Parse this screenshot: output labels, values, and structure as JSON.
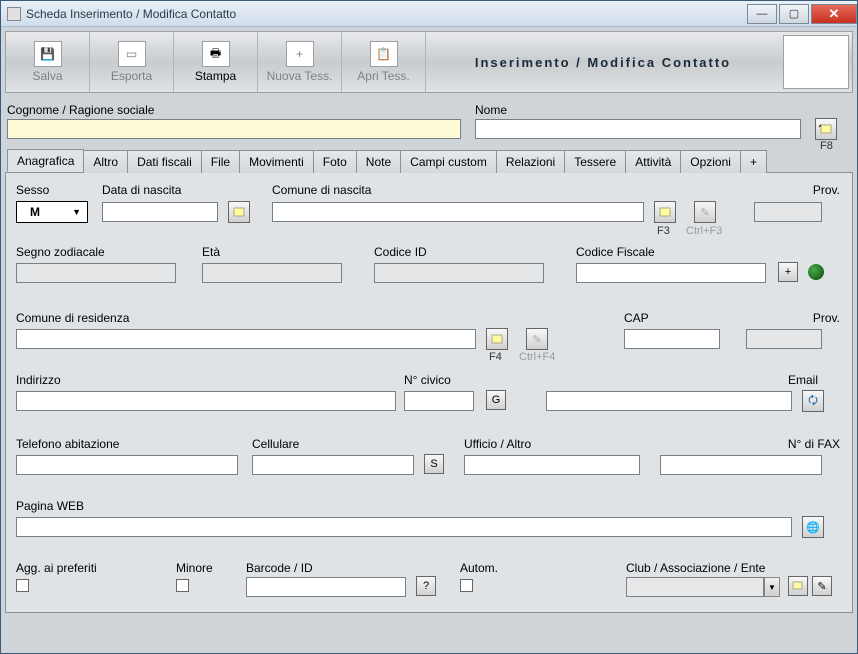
{
  "window": {
    "title": "Scheda Inserimento / Modifica Contatto"
  },
  "toolbar": {
    "salva": "Salva",
    "esporta": "Esporta",
    "stampa": "Stampa",
    "nuova_tess": "Nuova Tess.",
    "apri_tess": "Apri Tess.",
    "header_title": "Inserimento / Modifica  Contatto"
  },
  "head": {
    "cognome_label": "Cognome / Ragione sociale",
    "nome_label": "Nome",
    "f8": "F8"
  },
  "tabs": {
    "anagrafica": "Anagrafica",
    "altro": "Altro",
    "dati_fiscali": "Dati fiscali",
    "file": "File",
    "movimenti": "Movimenti",
    "foto": "Foto",
    "note": "Note",
    "campi_custom": "Campi custom",
    "relazioni": "Relazioni",
    "tessere": "Tessere",
    "attivita": "Attività",
    "opzioni": "Opzioni",
    "plus": "+"
  },
  "form": {
    "sesso": "Sesso",
    "sesso_value": "M",
    "data_nascita": "Data di nascita",
    "comune_nascita": "Comune di nascita",
    "prov": "Prov.",
    "f3": "F3",
    "ctrl_f3": "Ctrl+F3",
    "segno": "Segno zodiacale",
    "eta": "Età",
    "codice_id": "Codice ID",
    "codice_fiscale": "Codice Fiscale",
    "plus": "+",
    "comune_res": "Comune di residenza",
    "f4": "F4",
    "ctrl_f4": "Ctrl+F4",
    "cap": "CAP",
    "indirizzo": "Indirizzo",
    "ncivico": "N° civico",
    "g": "G",
    "email": "Email",
    "tel_abit": "Telefono abitazione",
    "cell": "Cellulare",
    "s": "S",
    "uff": "Ufficio / Altro",
    "nfax": "N° di FAX",
    "pagina_web": "Pagina WEB",
    "agg_pref": "Agg. ai preferiti",
    "minore": "Minore",
    "barcode": "Barcode / ID",
    "q": "?",
    "autom": "Autom.",
    "club": "Club / Associazione / Ente"
  }
}
